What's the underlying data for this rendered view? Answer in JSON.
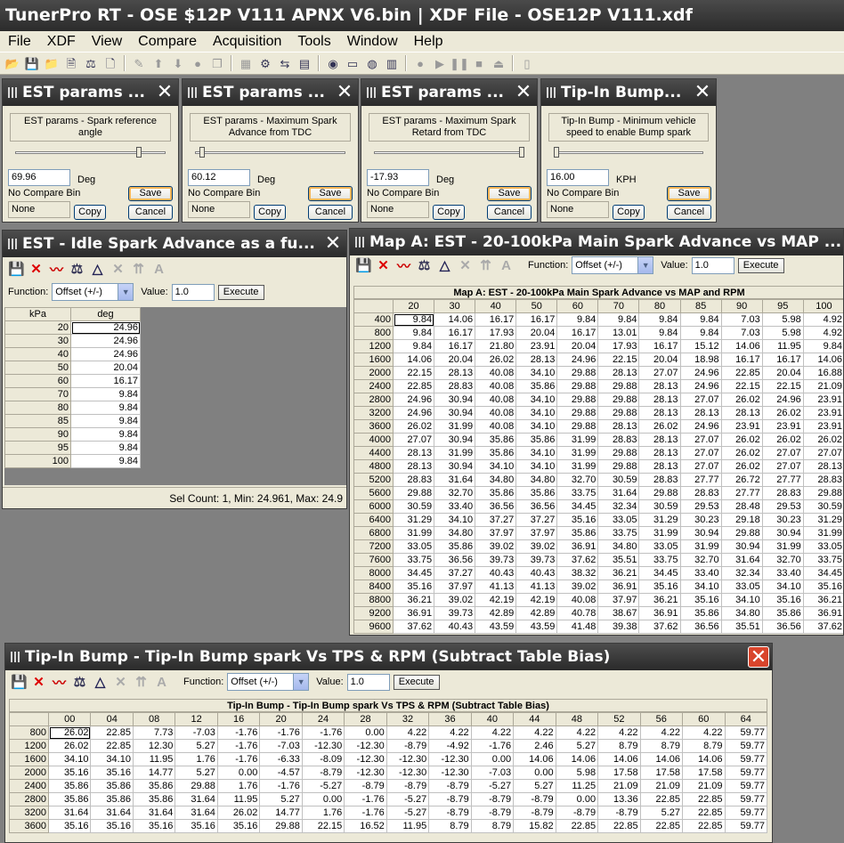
{
  "app": {
    "title": "TunerPro RT - OSE $12P V111 APNX V6.bin | XDF File - OSE12P V111.xdf"
  },
  "menu": [
    "File",
    "XDF",
    "View",
    "Compare",
    "Acquisition",
    "Tools",
    "Window",
    "Help"
  ],
  "toolbar_icons": [
    "open-icon",
    "save-icon",
    "folder-icon",
    "bin-icon",
    "compare-icon",
    "new-icon",
    "wand-icon",
    "up-arrow-icon",
    "down-arrow-icon",
    "circle-icon",
    "copy-icon",
    "chip-icon",
    "settings-icon",
    "swap-icon",
    "grid-icon",
    "record-icon",
    "note-icon",
    "graph-icon",
    "chart-icon",
    "stop-icon",
    "play-icon",
    "pause-icon",
    "stop-square-icon",
    "eject-icon",
    "slider-icon"
  ],
  "params": [
    {
      "title": "EST params ...",
      "desc": "EST params - Spark reference angle",
      "value": "69.96",
      "unit": "Deg",
      "compare": "No Compare Bin",
      "compare_value": "None",
      "save": "Save",
      "copy": "Copy",
      "cancel": "Cancel",
      "thumb_pct": 0.82
    },
    {
      "title": "EST params ...",
      "desc": "EST params - Maximum Spark Advance from TDC",
      "value": "60.12",
      "unit": "Deg",
      "compare": "No Compare Bin",
      "compare_value": "None",
      "save": "Save",
      "copy": "Copy",
      "cancel": "Cancel",
      "thumb_pct": 0.05
    },
    {
      "title": "EST params ...",
      "desc": "EST params - Maximum Spark Retard from TDC",
      "value": "-17.93",
      "unit": "Deg",
      "compare": "No Compare Bin",
      "compare_value": "None",
      "save": "Save",
      "copy": "Copy",
      "cancel": "Cancel",
      "thumb_pct": 0.98
    },
    {
      "title": "Tip-In Bump...",
      "desc": "Tip-In Bump - Minimum vehicle speed to enable Bump spark",
      "value": "16.00",
      "unit": "KPH",
      "compare": "No Compare Bin",
      "compare_value": "None",
      "save": "Save",
      "copy": "Copy",
      "cancel": "Cancel",
      "thumb_pct": 0.02
    }
  ],
  "function_label": "Function:",
  "function_value": "Offset (+/-)",
  "value_label": "Value:",
  "value_value": "1.0",
  "execute": "Execute",
  "idle": {
    "title": "EST - Idle Spark Advance as a fu...",
    "col_kpa": "kPa",
    "col_deg": "deg",
    "rows": [
      [
        "20",
        "24.96"
      ],
      [
        "30",
        "24.96"
      ],
      [
        "40",
        "24.96"
      ],
      [
        "50",
        "20.04"
      ],
      [
        "60",
        "16.17"
      ],
      [
        "70",
        "9.84"
      ],
      [
        "80",
        "9.84"
      ],
      [
        "85",
        "9.84"
      ],
      [
        "90",
        "9.84"
      ],
      [
        "95",
        "9.84"
      ],
      [
        "100",
        "9.84"
      ]
    ],
    "status": "Sel Count: 1, Min: 24.961, Max: 24.9"
  },
  "mapa": {
    "title": "Map A: EST - 20-100kPa Main Spark Advance vs MAP ...",
    "caption": "Map A: EST - 20-100kPa Main Spark Advance vs MAP and RPM",
    "cols": [
      "20",
      "30",
      "40",
      "50",
      "60",
      "70",
      "80",
      "85",
      "90",
      "95",
      "100"
    ],
    "rows": [
      [
        "400",
        "9.84",
        "14.06",
        "16.17",
        "16.17",
        "9.84",
        "9.84",
        "9.84",
        "9.84",
        "7.03",
        "5.98",
        "4.92"
      ],
      [
        "800",
        "9.84",
        "16.17",
        "17.93",
        "20.04",
        "16.17",
        "13.01",
        "9.84",
        "9.84",
        "7.03",
        "5.98",
        "4.92"
      ],
      [
        "1200",
        "9.84",
        "16.17",
        "21.80",
        "23.91",
        "20.04",
        "17.93",
        "16.17",
        "15.12",
        "14.06",
        "11.95",
        "9.84"
      ],
      [
        "1600",
        "14.06",
        "20.04",
        "26.02",
        "28.13",
        "24.96",
        "22.15",
        "20.04",
        "18.98",
        "16.17",
        "16.17",
        "14.06"
      ],
      [
        "2000",
        "22.15",
        "28.13",
        "40.08",
        "34.10",
        "29.88",
        "28.13",
        "27.07",
        "24.96",
        "22.85",
        "20.04",
        "16.88"
      ],
      [
        "2400",
        "22.85",
        "28.83",
        "40.08",
        "35.86",
        "29.88",
        "29.88",
        "28.13",
        "24.96",
        "22.15",
        "22.15",
        "21.09"
      ],
      [
        "2800",
        "24.96",
        "30.94",
        "40.08",
        "34.10",
        "29.88",
        "29.88",
        "28.13",
        "27.07",
        "26.02",
        "24.96",
        "23.91"
      ],
      [
        "3200",
        "24.96",
        "30.94",
        "40.08",
        "34.10",
        "29.88",
        "29.88",
        "28.13",
        "28.13",
        "28.13",
        "26.02",
        "23.91"
      ],
      [
        "3600",
        "26.02",
        "31.99",
        "40.08",
        "34.10",
        "29.88",
        "28.13",
        "26.02",
        "24.96",
        "23.91",
        "23.91",
        "23.91"
      ],
      [
        "4000",
        "27.07",
        "30.94",
        "35.86",
        "35.86",
        "31.99",
        "28.83",
        "28.13",
        "27.07",
        "26.02",
        "26.02",
        "26.02"
      ],
      [
        "4400",
        "28.13",
        "31.99",
        "35.86",
        "34.10",
        "31.99",
        "29.88",
        "28.13",
        "27.07",
        "26.02",
        "27.07",
        "27.07"
      ],
      [
        "4800",
        "28.13",
        "30.94",
        "34.10",
        "34.10",
        "31.99",
        "29.88",
        "28.13",
        "27.07",
        "26.02",
        "27.07",
        "28.13"
      ],
      [
        "5200",
        "28.83",
        "31.64",
        "34.80",
        "34.80",
        "32.70",
        "30.59",
        "28.83",
        "27.77",
        "26.72",
        "27.77",
        "28.83"
      ],
      [
        "5600",
        "29.88",
        "32.70",
        "35.86",
        "35.86",
        "33.75",
        "31.64",
        "29.88",
        "28.83",
        "27.77",
        "28.83",
        "29.88"
      ],
      [
        "6000",
        "30.59",
        "33.40",
        "36.56",
        "36.56",
        "34.45",
        "32.34",
        "30.59",
        "29.53",
        "28.48",
        "29.53",
        "30.59"
      ],
      [
        "6400",
        "31.29",
        "34.10",
        "37.27",
        "37.27",
        "35.16",
        "33.05",
        "31.29",
        "30.23",
        "29.18",
        "30.23",
        "31.29"
      ],
      [
        "6800",
        "31.99",
        "34.80",
        "37.97",
        "37.97",
        "35.86",
        "33.75",
        "31.99",
        "30.94",
        "29.88",
        "30.94",
        "31.99"
      ],
      [
        "7200",
        "33.05",
        "35.86",
        "39.02",
        "39.02",
        "36.91",
        "34.80",
        "33.05",
        "31.99",
        "30.94",
        "31.99",
        "33.05"
      ],
      [
        "7600",
        "33.75",
        "36.56",
        "39.73",
        "39.73",
        "37.62",
        "35.51",
        "33.75",
        "32.70",
        "31.64",
        "32.70",
        "33.75"
      ],
      [
        "8000",
        "34.45",
        "37.27",
        "40.43",
        "40.43",
        "38.32",
        "36.21",
        "34.45",
        "33.40",
        "32.34",
        "33.40",
        "34.45"
      ],
      [
        "8400",
        "35.16",
        "37.97",
        "41.13",
        "41.13",
        "39.02",
        "36.91",
        "35.16",
        "34.10",
        "33.05",
        "34.10",
        "35.16"
      ],
      [
        "8800",
        "36.21",
        "39.02",
        "42.19",
        "42.19",
        "40.08",
        "37.97",
        "36.21",
        "35.16",
        "34.10",
        "35.16",
        "36.21"
      ],
      [
        "9200",
        "36.91",
        "39.73",
        "42.89",
        "42.89",
        "40.78",
        "38.67",
        "36.91",
        "35.86",
        "34.80",
        "35.86",
        "36.91"
      ],
      [
        "9600",
        "37.62",
        "40.43",
        "43.59",
        "43.59",
        "41.48",
        "39.38",
        "37.62",
        "36.56",
        "35.51",
        "36.56",
        "37.62"
      ]
    ]
  },
  "tipin": {
    "title": "Tip-In Bump - Tip-In Bump spark Vs TPS & RPM  (Subtract Table Bias)",
    "caption": "Tip-In Bump - Tip-In Bump spark Vs TPS & RPM  (Subtract Table Bias)",
    "cols": [
      "00",
      "04",
      "08",
      "12",
      "16",
      "20",
      "24",
      "28",
      "32",
      "36",
      "40",
      "44",
      "48",
      "52",
      "56",
      "60",
      "64"
    ],
    "rows": [
      [
        "800",
        "26.02",
        "22.85",
        "7.73",
        "-7.03",
        "-1.76",
        "-1.76",
        "-1.76",
        "0.00",
        "4.22",
        "4.22",
        "4.22",
        "4.22",
        "4.22",
        "4.22",
        "4.22",
        "4.22",
        "59.77"
      ],
      [
        "1200",
        "26.02",
        "22.85",
        "12.30",
        "5.27",
        "-1.76",
        "-7.03",
        "-12.30",
        "-12.30",
        "-8.79",
        "-4.92",
        "-1.76",
        "2.46",
        "5.27",
        "8.79",
        "8.79",
        "8.79",
        "59.77"
      ],
      [
        "1600",
        "34.10",
        "34.10",
        "11.95",
        "1.76",
        "-1.76",
        "-6.33",
        "-8.09",
        "-12.30",
        "-12.30",
        "-12.30",
        "0.00",
        "14.06",
        "14.06",
        "14.06",
        "14.06",
        "14.06",
        "59.77"
      ],
      [
        "2000",
        "35.16",
        "35.16",
        "14.77",
        "5.27",
        "0.00",
        "-4.57",
        "-8.79",
        "-12.30",
        "-12.30",
        "-12.30",
        "-7.03",
        "0.00",
        "5.98",
        "17.58",
        "17.58",
        "17.58",
        "59.77"
      ],
      [
        "2400",
        "35.86",
        "35.86",
        "35.86",
        "29.88",
        "1.76",
        "-1.76",
        "-5.27",
        "-8.79",
        "-8.79",
        "-8.79",
        "-5.27",
        "5.27",
        "11.25",
        "21.09",
        "21.09",
        "21.09",
        "59.77"
      ],
      [
        "2800",
        "35.86",
        "35.86",
        "35.86",
        "31.64",
        "11.95",
        "5.27",
        "0.00",
        "-1.76",
        "-5.27",
        "-8.79",
        "-8.79",
        "-8.79",
        "0.00",
        "13.36",
        "22.85",
        "22.85",
        "59.77"
      ],
      [
        "3200",
        "31.64",
        "31.64",
        "31.64",
        "31.64",
        "26.02",
        "14.77",
        "1.76",
        "-1.76",
        "-5.27",
        "-8.79",
        "-8.79",
        "-8.79",
        "-8.79",
        "-8.79",
        "5.27",
        "22.85",
        "59.77"
      ],
      [
        "3600",
        "35.16",
        "35.16",
        "35.16",
        "35.16",
        "35.16",
        "29.88",
        "22.15",
        "16.52",
        "11.95",
        "8.79",
        "8.79",
        "15.82",
        "22.85",
        "22.85",
        "22.85",
        "22.85",
        "59.77"
      ]
    ]
  }
}
